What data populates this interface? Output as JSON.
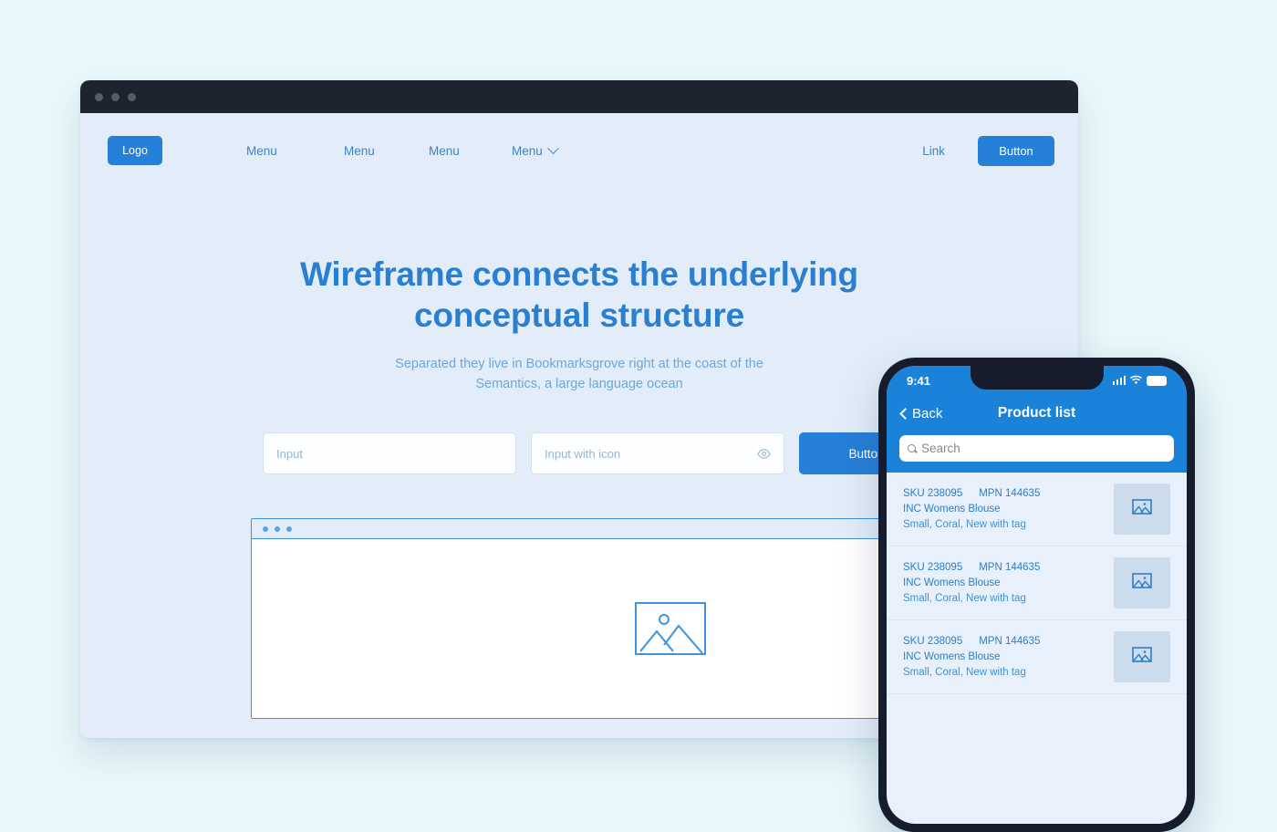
{
  "browser": {
    "titlebar_dots": 3,
    "nav": {
      "logo_label": "Logo",
      "menu_items": [
        {
          "label": "Menu",
          "has_chevron": false
        },
        {
          "label": "Menu",
          "has_chevron": false
        },
        {
          "label": "Menu",
          "has_chevron": false
        },
        {
          "label": "Menu",
          "has_chevron": true
        }
      ],
      "link_label": "Link",
      "button_label": "Button"
    },
    "hero": {
      "heading_line1": "Wireframe connects the underlying",
      "heading_line2": "conceptual structure",
      "subtext_line1": "Separated they live in Bookmarksgrove right at the coast of the",
      "subtext_line2": "Semantics, a large language ocean"
    },
    "inputs": {
      "field1_placeholder": "Input",
      "field2_placeholder": "Input with icon",
      "field2_icon": "eye-icon",
      "button_label": "Button"
    },
    "card": {
      "dots": 3,
      "placeholder_icon": "image-placeholder-icon"
    }
  },
  "phone": {
    "statusbar": {
      "time": "9:41",
      "icons": [
        "signal-icon",
        "wifi-icon",
        "battery-icon"
      ]
    },
    "navbar": {
      "back_label": "Back",
      "title": "Product list"
    },
    "search": {
      "placeholder": "Search",
      "icon": "search-icon"
    },
    "products": [
      {
        "sku": "SKU 238095",
        "mpn": "MPN 144635",
        "name": "INC Womens Blouse",
        "attributes": "Small, Coral, New with tag",
        "thumb_icon": "image-icon"
      },
      {
        "sku": "SKU 238095",
        "mpn": "MPN 144635",
        "name": "INC Womens Blouse",
        "attributes": "Small, Coral, New with tag",
        "thumb_icon": "image-icon"
      },
      {
        "sku": "SKU 238095",
        "mpn": "MPN 144635",
        "name": "INC Womens Blouse",
        "attributes": "Small, Coral, New with tag",
        "thumb_icon": "image-icon"
      }
    ]
  },
  "colors": {
    "page_background": "#e8f8fb",
    "browser_titlebar": "#1e2330",
    "browser_background": "#e3edf9",
    "primary_blue": "#2680d8",
    "heading_blue": "#2b7fd0",
    "subtext_blue": "#6ea6da",
    "phone_header_blue": "#1b82da",
    "phone_screen_bg": "#e7f0fb",
    "thumb_bg": "#ccdcec"
  }
}
